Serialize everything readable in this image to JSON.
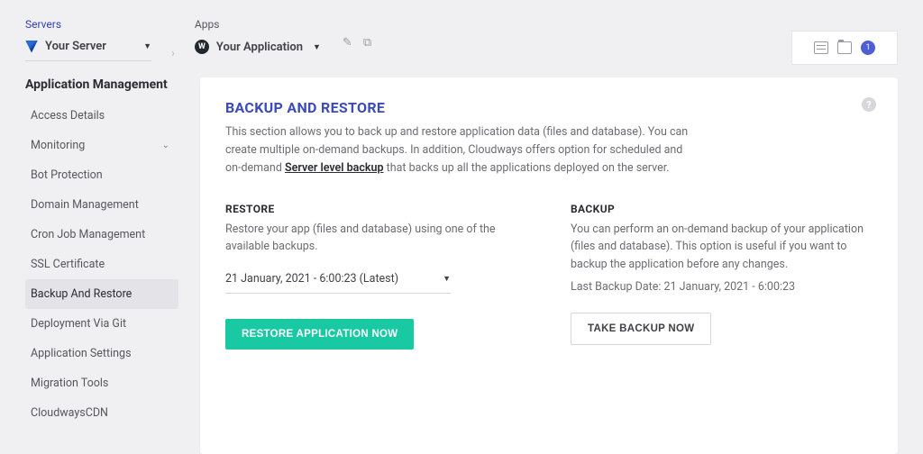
{
  "breadcrumbs": {
    "servers_label": "Servers",
    "server_name": "Your Server",
    "apps_label": "Apps",
    "app_name": "Your Application"
  },
  "topright": {
    "badge_count": "1"
  },
  "sidebar": {
    "heading": "Application Management",
    "items": [
      "Access Details",
      "Monitoring",
      "Bot Protection",
      "Domain Management",
      "Cron Job Management",
      "SSL Certificate",
      "Backup And Restore",
      "Deployment Via Git",
      "Application Settings",
      "Migration Tools",
      "CloudwaysCDN"
    ],
    "active_index": 6,
    "expandable_index": 1
  },
  "content": {
    "title": "BACKUP AND RESTORE",
    "description_pre": "This section allows you to back up and restore application data (files and database). You can create multiple on-demand backups. In addition, Cloudways offers option for scheduled and on-demand ",
    "description_link": "Server level backup",
    "description_post": " that backs up all the applications deployed on the server."
  },
  "restore": {
    "heading": "RESTORE",
    "text": "Restore your app (files and database) using one of the available backups.",
    "selected_backup": "21 January, 2021 - 6:00:23 (Latest)",
    "button": "RESTORE APPLICATION NOW"
  },
  "backup": {
    "heading": "BACKUP",
    "text": "You can perform an on-demand backup of your application (files and database). This option is useful if you want to backup the application before any changes.",
    "last_backup_label": "Last Backup Date: ",
    "last_backup_value": "21 January, 2021 - 6:00:23",
    "button": "TAKE BACKUP NOW"
  }
}
